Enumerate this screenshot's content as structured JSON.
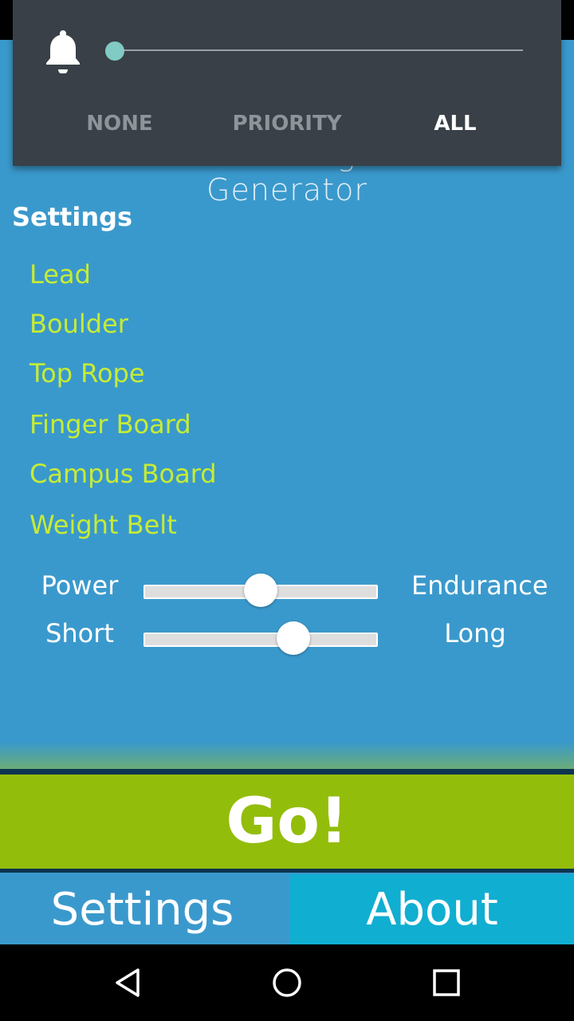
{
  "app": {
    "title": "Random Climbing Workout Generator"
  },
  "settings": {
    "heading": "Settings",
    "options": [
      "Lead",
      "Boulder",
      "Top Rope",
      "Finger Board",
      "Campus Board",
      "Weight Belt"
    ],
    "sliders": [
      {
        "left_label": "Power",
        "right_label": "Endurance",
        "value": 0.5
      },
      {
        "left_label": "Short",
        "right_label": "Long",
        "value": 0.64
      }
    ]
  },
  "actions": {
    "go_label": "Go!"
  },
  "tabs": {
    "settings_label": "Settings",
    "about_label": "About"
  },
  "volume_panel": {
    "level": 0.0,
    "modes": [
      "NONE",
      "PRIORITY",
      "ALL"
    ],
    "selected_mode": "ALL",
    "icon": "bell-icon"
  },
  "nav": {
    "back_icon": "back-icon",
    "home_icon": "home-icon",
    "recents_icon": "recents-icon"
  },
  "colors": {
    "background": "#3a99cc",
    "option_text": "#c6ec35",
    "go_button": "#93bd0b",
    "about_tab": "#10aed1",
    "panel": "#394047"
  }
}
